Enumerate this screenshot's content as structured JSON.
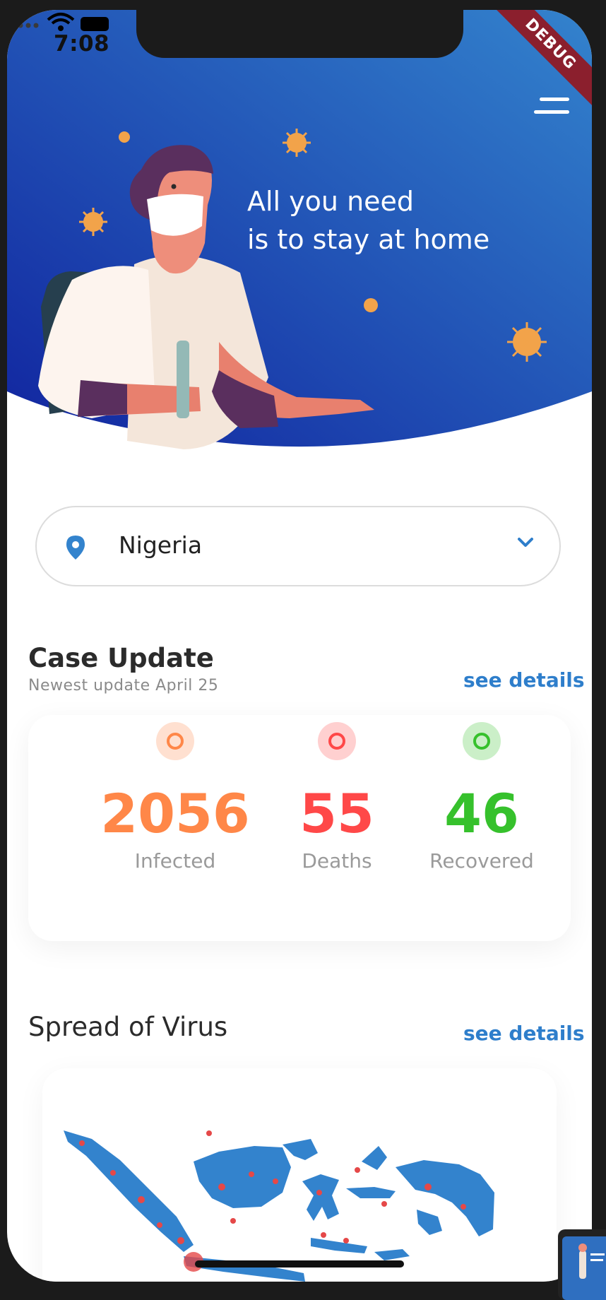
{
  "status_bar": {
    "time": "7:08",
    "debug_banner": "DEBUG"
  },
  "hero": {
    "line1": "All you need",
    "line2": "is to stay at home",
    "gradient_start": "#3383CD",
    "gradient_end": "#11249F"
  },
  "location": {
    "selected": "Nigeria",
    "icon": "location-pin-icon"
  },
  "case_update": {
    "title": "Case Update",
    "subtitle": "Newest update April 25",
    "see_details": "see details",
    "stats": [
      {
        "value": "2056",
        "label": "Infected",
        "color": "#FF8748"
      },
      {
        "value": "55",
        "label": "Deaths",
        "color": "#FF4848"
      },
      {
        "value": "46",
        "label": "Recovered",
        "color": "#36C12C"
      }
    ]
  },
  "spread": {
    "title": "Spread of Virus",
    "see_details": "see details",
    "map_color": "#3383CD"
  },
  "colors": {
    "accent": "#2E7ECB",
    "text": "#2B2B2B",
    "muted": "#8A8A8A"
  }
}
